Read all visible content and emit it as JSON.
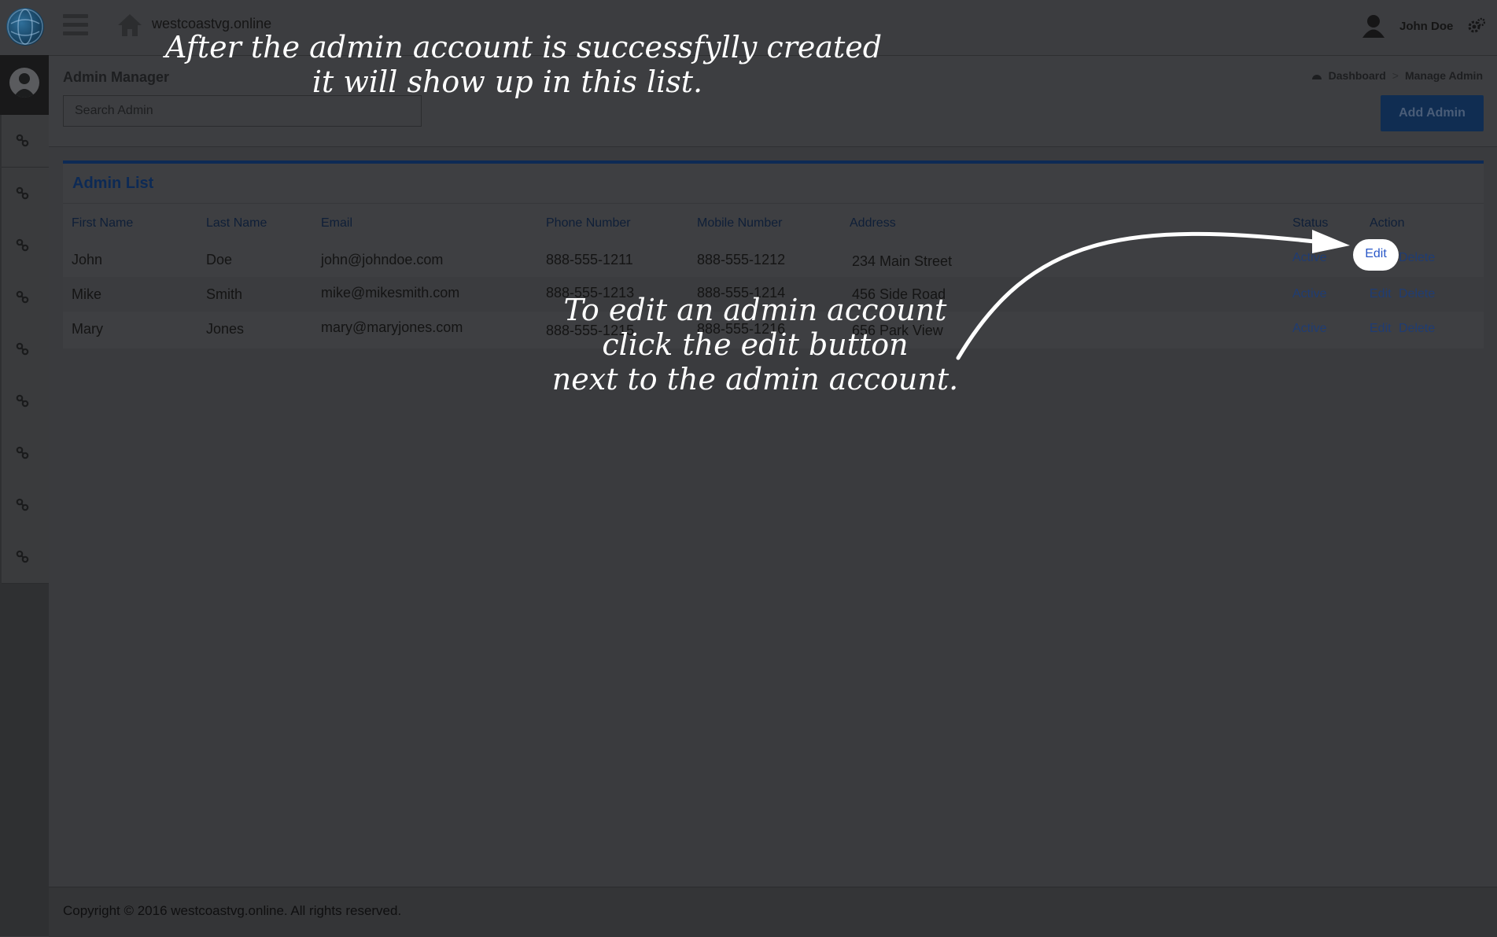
{
  "topbar": {
    "site_name": "westcoastvg.online",
    "user_name": "John Doe"
  },
  "page": {
    "title": "Admin Manager",
    "search_placeholder": "Search Admin",
    "breadcrumb": [
      "Dashboard",
      "Manage Admin"
    ],
    "add_button": "Add Admin"
  },
  "admin_list": {
    "title": "Admin List",
    "columns": [
      "First Name",
      "Last Name",
      "Email",
      "Phone Number",
      "Mobile Number",
      "Address",
      "Status",
      "Action"
    ],
    "rows": [
      {
        "first": "John",
        "last": "Doe",
        "email": "john@johndoe.com",
        "phone": "888-555-1211",
        "mobile": "888-555-1212",
        "address": "234 Main Street",
        "status": "Active",
        "edit": "Edit",
        "delete": "Delete"
      },
      {
        "first": "Mike",
        "last": "Smith",
        "email": "mike@mikesmith.com",
        "phone": "888-555-1213",
        "mobile": "888-555-1214",
        "address": "456 Side Road",
        "status": "Active",
        "edit": "Edit",
        "delete": "Delete"
      },
      {
        "first": "Mary",
        "last": "Jones",
        "email": "mary@maryjones.com",
        "phone": "888-555-1215",
        "mobile": "888-555-1216",
        "address": "656 Park View",
        "status": "Active",
        "edit": "Edit",
        "delete": "Delete"
      }
    ]
  },
  "footer": {
    "text": "Copyright © 2016 westcoastvg.online. All rights reserved."
  },
  "annotations": {
    "top_line1": "After the admin account is successfylly created",
    "top_line2": "it will show up in this list.",
    "mid_line1": "To edit an admin account",
    "mid_line2": "click the edit button",
    "mid_line3": "next to the admin account."
  },
  "sidebar": {
    "items": [
      "link-icon",
      "link-icon",
      "link-icon",
      "link-icon",
      "link-icon",
      "link-icon",
      "link-icon",
      "link-icon",
      "link-icon"
    ]
  }
}
